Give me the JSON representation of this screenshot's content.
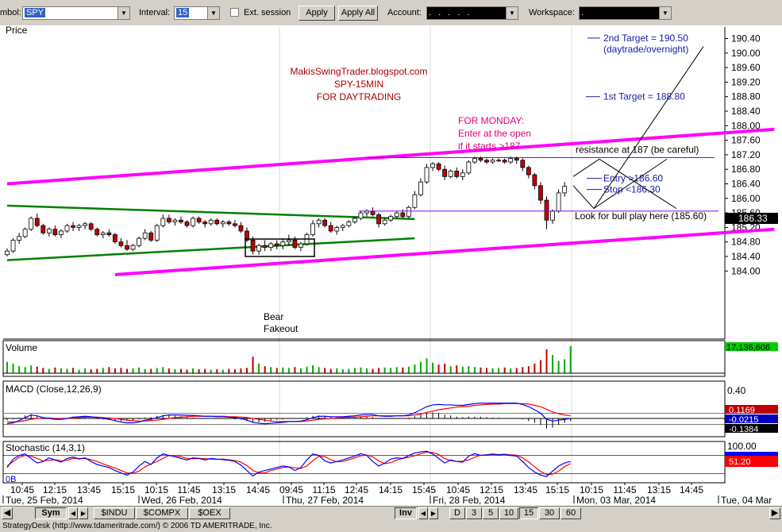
{
  "toolbar": {
    "symbol_label": "mbol:",
    "symbol_value": "SPY",
    "interval_label": "Interval:",
    "interval_value": "15",
    "ext_session_label": "Ext. session",
    "apply_label": "Apply",
    "apply_all_label": "Apply All",
    "account_label": "Account:",
    "account_value": ". . . . .",
    "workspace_label": "Workspace:",
    "workspace_value": "."
  },
  "bottom_bar": {
    "sym_label": "Sym",
    "symbols": [
      "$INDU",
      "$COMPX",
      "$OEX"
    ],
    "inv_label": "Inv",
    "intervals": [
      "D",
      "3",
      "5",
      "10",
      "15",
      "30",
      "60"
    ],
    "active_interval": "15"
  },
  "status_bar": "StrategyDesk (http://www.tdameritrade.com/) © 2006 TD AMERITRADE, Inc.",
  "colors": {
    "channel": "#ff00ff",
    "wedge": "#008000",
    "up_candle": "#00aa00",
    "down_candle": "#c00000",
    "annotation_blue": "#1a1aaa",
    "annotation_red": "#aa0000",
    "annotation_magenta": "#e0007f",
    "macd_line": "#0000ff",
    "signal_line": "#ff0000"
  },
  "chart_data": {
    "type": "candlestick",
    "symbol": "SPY",
    "interval": "15 min",
    "price_panel": {
      "title": "Price",
      "y_ticks": [
        184.0,
        184.4,
        184.8,
        185.2,
        185.6,
        186.0,
        186.4,
        186.8,
        187.2,
        187.6,
        188.0,
        188.4,
        188.8,
        189.2,
        189.6,
        190.0,
        190.4
      ],
      "last_price": "186.33",
      "bars": [
        [
          184.45,
          184.62,
          184.4,
          184.55
        ],
        [
          184.55,
          184.9,
          184.5,
          184.85
        ],
        [
          184.85,
          185.05,
          184.75,
          184.95
        ],
        [
          184.95,
          185.2,
          184.9,
          185.15
        ],
        [
          185.15,
          185.5,
          185.1,
          185.45
        ],
        [
          185.45,
          185.58,
          185.2,
          185.25
        ],
        [
          185.25,
          185.3,
          185.0,
          185.05
        ],
        [
          185.05,
          185.2,
          184.95,
          185.15
        ],
        [
          185.15,
          185.25,
          184.95,
          185.0
        ],
        [
          185.0,
          185.15,
          184.9,
          185.1
        ],
        [
          185.1,
          185.3,
          185.05,
          185.25
        ],
        [
          185.25,
          185.35,
          185.1,
          185.2
        ],
        [
          185.2,
          185.3,
          185.1,
          185.25
        ],
        [
          185.25,
          185.35,
          185.15,
          185.3
        ],
        [
          185.3,
          185.35,
          185.1,
          185.15
        ],
        [
          185.15,
          185.2,
          184.95,
          185.0
        ],
        [
          185.0,
          185.1,
          184.9,
          185.05
        ],
        [
          185.05,
          185.15,
          184.95,
          185.0
        ],
        [
          185.0,
          185.05,
          184.75,
          184.8
        ],
        [
          184.8,
          184.9,
          184.65,
          184.7
        ],
        [
          184.7,
          184.85,
          184.55,
          184.6
        ],
        [
          184.6,
          184.75,
          184.55,
          184.7
        ],
        [
          184.7,
          184.95,
          184.65,
          184.9
        ],
        [
          184.9,
          185.15,
          184.85,
          185.05
        ],
        [
          185.05,
          185.1,
          184.8,
          184.85
        ],
        [
          184.85,
          185.3,
          184.8,
          185.25
        ],
        [
          185.25,
          185.55,
          185.2,
          185.45
        ],
        [
          185.45,
          185.55,
          185.3,
          185.35
        ],
        [
          185.35,
          185.45,
          185.25,
          185.4
        ],
        [
          185.4,
          185.5,
          185.3,
          185.35
        ],
        [
          185.35,
          185.4,
          185.2,
          185.25
        ],
        [
          185.25,
          185.5,
          185.2,
          185.45
        ],
        [
          185.45,
          185.5,
          185.3,
          185.35
        ],
        [
          185.35,
          185.4,
          185.2,
          185.3
        ],
        [
          185.3,
          185.45,
          185.25,
          185.4
        ],
        [
          185.4,
          185.45,
          185.25,
          185.3
        ],
        [
          185.3,
          185.4,
          185.2,
          185.35
        ],
        [
          185.35,
          185.4,
          185.25,
          185.3
        ],
        [
          185.3,
          185.4,
          185.2,
          185.25
        ],
        [
          185.25,
          185.35,
          185.05,
          185.1
        ],
        [
          185.1,
          185.2,
          184.8,
          184.85
        ],
        [
          184.85,
          184.95,
          184.45,
          184.55
        ],
        [
          184.55,
          184.75,
          184.45,
          184.7
        ],
        [
          184.7,
          184.85,
          184.55,
          184.65
        ],
        [
          184.65,
          184.8,
          184.55,
          184.75
        ],
        [
          184.75,
          184.85,
          184.6,
          184.7
        ],
        [
          184.7,
          184.9,
          184.6,
          184.8
        ],
        [
          184.8,
          185.0,
          184.7,
          184.85
        ],
        [
          184.85,
          184.95,
          184.6,
          184.65
        ],
        [
          184.65,
          184.8,
          184.55,
          184.75
        ],
        [
          184.75,
          185.05,
          184.7,
          185.0
        ],
        [
          185.0,
          185.4,
          184.95,
          185.3
        ],
        [
          185.3,
          185.45,
          185.2,
          185.4
        ],
        [
          185.4,
          185.45,
          185.2,
          185.25
        ],
        [
          185.25,
          185.35,
          185.05,
          185.1
        ],
        [
          185.1,
          185.25,
          185.0,
          185.2
        ],
        [
          185.2,
          185.3,
          185.1,
          185.25
        ],
        [
          185.25,
          185.4,
          185.2,
          185.35
        ],
        [
          185.35,
          185.5,
          185.3,
          185.45
        ],
        [
          185.45,
          185.65,
          185.4,
          185.6
        ],
        [
          185.6,
          185.7,
          185.5,
          185.65
        ],
        [
          185.65,
          185.75,
          185.5,
          185.55
        ],
        [
          185.55,
          185.6,
          185.2,
          185.3
        ],
        [
          185.3,
          185.45,
          185.25,
          185.4
        ],
        [
          185.4,
          185.55,
          185.35,
          185.5
        ],
        [
          185.5,
          185.65,
          185.45,
          185.6
        ],
        [
          185.6,
          185.7,
          185.45,
          185.5
        ],
        [
          185.5,
          185.8,
          185.45,
          185.75
        ],
        [
          185.75,
          186.2,
          185.7,
          186.1
        ],
        [
          186.1,
          186.55,
          186.05,
          186.45
        ],
        [
          186.45,
          186.95,
          186.4,
          186.85
        ],
        [
          186.85,
          187.0,
          186.75,
          186.95
        ],
        [
          186.95,
          187.0,
          186.75,
          186.8
        ],
        [
          186.8,
          186.9,
          186.5,
          186.6
        ],
        [
          186.6,
          186.8,
          186.55,
          186.75
        ],
        [
          186.75,
          186.85,
          186.55,
          186.6
        ],
        [
          186.6,
          186.8,
          186.5,
          186.7
        ],
        [
          186.7,
          187.05,
          186.65,
          187.0
        ],
        [
          187.0,
          187.15,
          186.95,
          187.1
        ],
        [
          187.1,
          187.15,
          187.0,
          187.05
        ],
        [
          187.05,
          187.1,
          186.95,
          187.0
        ],
        [
          187.0,
          187.1,
          186.95,
          187.05
        ],
        [
          187.05,
          187.1,
          187.0,
          187.05
        ],
        [
          187.05,
          187.1,
          186.95,
          187.0
        ],
        [
          187.0,
          187.15,
          186.95,
          187.1
        ],
        [
          187.1,
          187.15,
          186.95,
          187.05
        ],
        [
          187.05,
          187.1,
          186.75,
          186.85
        ],
        [
          186.85,
          186.9,
          186.55,
          186.65
        ],
        [
          186.65,
          186.7,
          186.25,
          186.35
        ],
        [
          186.35,
          186.45,
          185.85,
          185.95
        ],
        [
          185.95,
          186.05,
          185.15,
          185.4
        ],
        [
          185.4,
          185.7,
          185.3,
          185.65
        ],
        [
          185.65,
          186.25,
          185.6,
          186.15
        ],
        [
          186.15,
          186.45,
          186.05,
          186.33
        ]
      ],
      "trendlines": [
        {
          "name": "upper-channel",
          "from": [
            0,
            186.4
          ],
          "to": [
            128,
            187.9
          ]
        },
        {
          "name": "lower-channel",
          "from": [
            18,
            183.9
          ],
          "to": [
            128,
            185.15
          ]
        },
        {
          "name": "wedge-top",
          "from": [
            0,
            185.8
          ],
          "to": [
            68,
            185.43
          ]
        },
        {
          "name": "wedge-bottom",
          "from": [
            0,
            184.3
          ],
          "to": [
            68,
            184.9
          ]
        }
      ],
      "levels": [
        {
          "label": "resistance at 187 (be careful)",
          "value": 187.12
        },
        {
          "label": "Look for bull play here (185.60)",
          "value": 185.65
        },
        {
          "label": "Entry >186.60",
          "value": 186.55
        },
        {
          "label": "Stop <186.30",
          "value": 186.42
        },
        {
          "label": "1st Target = 188.80",
          "value": 188.8
        },
        {
          "label": "2nd Target = 190.50",
          "value": 190.5
        }
      ],
      "annotations": {
        "title_lines": [
          "MakisSwingTrader.blogspot.com",
          "SPY-15MIN",
          "FOR DAYTRADING"
        ],
        "monday_lines": [
          "FOR MONDAY:",
          "Enter at the open",
          "if it starts >187"
        ],
        "fakeout_lines": [
          "Bear",
          "Fakeout"
        ],
        "second_target_sub": "(daytrade/overnight)"
      }
    },
    "volume_panel": {
      "title": "Volume",
      "last_value": "17,136,606",
      "bars": [
        0.26,
        0.22,
        0.16,
        0.14,
        0.18,
        0.15,
        0.12,
        0.1,
        0.13,
        0.11,
        0.1,
        0.12,
        0.08,
        0.11,
        0.09,
        0.1,
        0.12,
        0.14,
        0.11,
        0.12,
        0.1,
        0.11,
        0.13,
        0.09,
        0.1,
        0.12,
        0.14,
        0.11,
        0.09,
        0.1,
        0.08,
        0.11,
        0.09,
        0.1,
        0.08,
        0.09,
        0.08,
        0.1,
        0.09,
        0.11,
        0.12,
        0.38,
        0.22,
        0.16,
        0.14,
        0.12,
        0.13,
        0.12,
        0.14,
        0.11,
        0.15,
        0.18,
        0.14,
        0.12,
        0.1,
        0.11,
        0.09,
        0.1,
        0.12,
        0.13,
        0.11,
        0.1,
        0.12,
        0.13,
        0.12,
        0.14,
        0.13,
        0.15,
        0.2,
        0.26,
        0.34,
        0.24,
        0.2,
        0.22,
        0.16,
        0.18,
        0.15,
        0.16,
        0.14,
        0.13,
        0.12,
        0.11,
        0.12,
        0.13,
        0.11,
        0.12,
        0.14,
        0.16,
        0.22,
        0.3,
        0.55,
        0.42,
        0.28,
        0.32,
        0.62
      ],
      "up_down": "ohlc"
    },
    "macd_panel": {
      "title": "MACD (Close,12,26,9)",
      "y_labels": [
        "0.40"
      ],
      "readouts": [
        "0.1169",
        "-0.0215",
        "-0.1384"
      ],
      "macd": [
        -0.12,
        -0.1,
        -0.05,
        0.02,
        0.08,
        0.06,
        0.02,
        0.0,
        -0.02,
        -0.02,
        0.0,
        0.03,
        0.04,
        0.05,
        0.04,
        0.02,
        0.0,
        -0.02,
        -0.05,
        -0.08,
        -0.1,
        -0.1,
        -0.08,
        -0.04,
        -0.02,
        0.02,
        0.06,
        0.08,
        0.08,
        0.08,
        0.07,
        0.07,
        0.06,
        0.05,
        0.05,
        0.04,
        0.04,
        0.03,
        0.02,
        0.0,
        -0.04,
        -0.09,
        -0.11,
        -0.12,
        -0.11,
        -0.1,
        -0.09,
        -0.07,
        -0.07,
        -0.06,
        -0.03,
        0.02,
        0.05,
        0.05,
        0.04,
        0.04,
        0.04,
        0.05,
        0.06,
        0.08,
        0.09,
        0.09,
        0.06,
        0.05,
        0.05,
        0.06,
        0.06,
        0.08,
        0.13,
        0.2,
        0.27,
        0.31,
        0.32,
        0.31,
        0.31,
        0.3,
        0.3,
        0.32,
        0.34,
        0.35,
        0.35,
        0.35,
        0.35,
        0.35,
        0.35,
        0.35,
        0.32,
        0.27,
        0.2,
        0.12,
        -0.02,
        -0.06,
        -0.04,
        -0.02,
        0.0
      ],
      "signal": [
        -0.08,
        -0.08,
        -0.07,
        -0.05,
        -0.02,
        0.0,
        0.01,
        0.01,
        0.0,
        0.0,
        0.0,
        0.01,
        0.02,
        0.03,
        0.03,
        0.03,
        0.02,
        0.01,
        0.0,
        -0.02,
        -0.04,
        -0.05,
        -0.06,
        -0.06,
        -0.05,
        -0.04,
        -0.02,
        0.0,
        0.02,
        0.03,
        0.04,
        0.05,
        0.05,
        0.05,
        0.05,
        0.05,
        0.05,
        0.04,
        0.04,
        0.03,
        0.02,
        0.0,
        -0.02,
        -0.04,
        -0.06,
        -0.07,
        -0.07,
        -0.07,
        -0.07,
        -0.07,
        -0.06,
        -0.04,
        -0.02,
        -0.01,
        0.0,
        0.01,
        0.02,
        0.03,
        0.03,
        0.04,
        0.05,
        0.06,
        0.06,
        0.06,
        0.06,
        0.06,
        0.06,
        0.06,
        0.08,
        0.1,
        0.14,
        0.17,
        0.2,
        0.22,
        0.24,
        0.26,
        0.27,
        0.28,
        0.3,
        0.31,
        0.32,
        0.33,
        0.33,
        0.34,
        0.34,
        0.34,
        0.34,
        0.33,
        0.3,
        0.27,
        0.21,
        0.15,
        0.11,
        0.08,
        0.06
      ]
    },
    "stoch_panel": {
      "title": "Stochastic (14,3,1)",
      "y_labels": [
        "100.00"
      ],
      "readouts": [
        "51.20"
      ],
      "left_label": "0B",
      "k": [
        40,
        68,
        80,
        85,
        70,
        55,
        60,
        72,
        65,
        58,
        70,
        75,
        68,
        72,
        60,
        50,
        45,
        40,
        30,
        22,
        15,
        25,
        45,
        60,
        50,
        72,
        85,
        80,
        76,
        70,
        65,
        72,
        70,
        65,
        70,
        68,
        66,
        64,
        60,
        48,
        30,
        12,
        25,
        30,
        35,
        40,
        45,
        42,
        30,
        40,
        65,
        85,
        80,
        62,
        55,
        60,
        65,
        72,
        78,
        86,
        80,
        60,
        45,
        55,
        68,
        72,
        70,
        80,
        88,
        92,
        94,
        85,
        70,
        55,
        65,
        60,
        58,
        78,
        86,
        80,
        82,
        85,
        82,
        84,
        80,
        78,
        60,
        40,
        25,
        15,
        10,
        28,
        45,
        55,
        60
      ],
      "d": [
        45,
        60,
        74,
        80,
        78,
        70,
        62,
        64,
        66,
        62,
        64,
        70,
        70,
        70,
        66,
        60,
        52,
        45,
        38,
        30,
        22,
        21,
        28,
        42,
        52,
        60,
        70,
        80,
        80,
        76,
        70,
        69,
        70,
        69,
        68,
        67,
        68,
        66,
        63,
        58,
        46,
        30,
        22,
        22,
        30,
        35,
        40,
        42,
        39,
        37,
        45,
        63,
        77,
        76,
        66,
        59,
        60,
        66,
        72,
        79,
        81,
        75,
        62,
        53,
        56,
        65,
        70,
        74,
        79,
        86,
        91,
        90,
        83,
        70,
        63,
        60,
        61,
        65,
        74,
        81,
        82,
        83,
        83,
        84,
        82,
        81,
        72,
        59,
        42,
        27,
        17,
        18,
        28,
        43,
        53
      ]
    },
    "x_axis": {
      "time_labels": [
        "10:45",
        "12:15",
        "13:45",
        "15:15",
        "10:15",
        "11:45",
        "13:15",
        "14:45",
        "09:45",
        "11:15",
        "12:45",
        "14:15",
        "15:45",
        "10:45",
        "12:15",
        "13:45",
        "15:15",
        "10:15",
        "11:45",
        "13:15",
        "14:45"
      ],
      "date_labels": [
        "Tue, 25 Feb, 2014",
        "Wed, 26 Feb, 2014",
        "Thu, 27 Feb, 2014",
        "Fri, 28 Feb, 2014",
        "Mon, 03 Mar, 2014",
        "Tue, 04 Mar"
      ]
    }
  }
}
